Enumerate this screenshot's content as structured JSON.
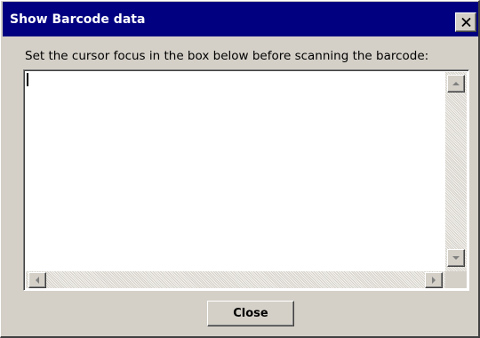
{
  "window": {
    "title": "Show Barcode data",
    "close_icon": "close-x-icon",
    "colors": {
      "titlebar": "#000080",
      "title_text": "#ffffff",
      "face": "#d4d0c8",
      "textbox_background": "#ffffff"
    }
  },
  "main": {
    "instruction": "Set the cursor focus in the box below before scanning the barcode:",
    "barcode_input": {
      "value": "",
      "focused": true
    },
    "scrollbars": {
      "vertical": {
        "up_icon": "arrow-up-icon",
        "down_icon": "arrow-down-icon"
      },
      "horizontal": {
        "left_icon": "arrow-left-icon",
        "right_icon": "arrow-right-icon"
      }
    }
  },
  "footer": {
    "close_label": "Close"
  }
}
